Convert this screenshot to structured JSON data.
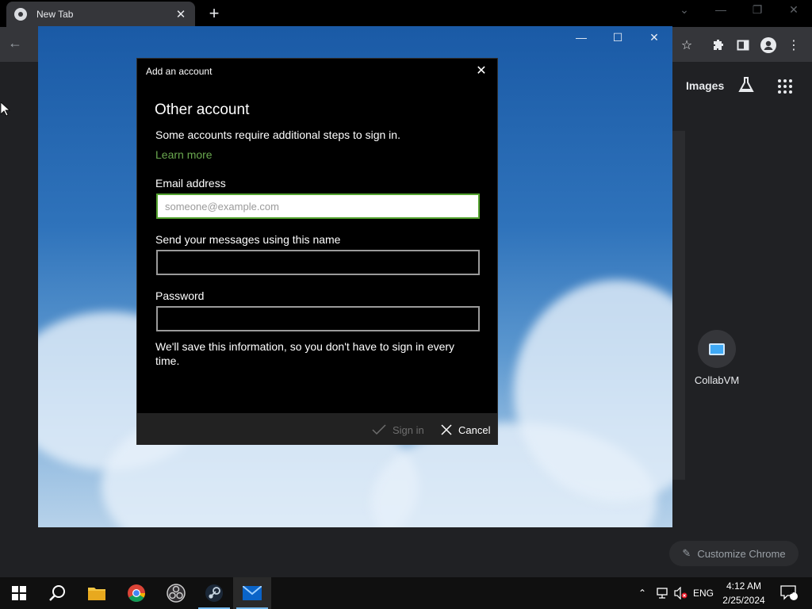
{
  "browser": {
    "tab_title": "New Tab",
    "tab_close": "✕",
    "new_tab": "+"
  },
  "page": {
    "images_link": "Images",
    "shortcut_label": "CollabVM",
    "customize_label": "Customize Chrome"
  },
  "dialog": {
    "title": "Add an account",
    "heading": "Other account",
    "description": "Some accounts require additional steps to sign in.",
    "learn_more": "Learn more",
    "email_label": "Email address",
    "email_placeholder": "someone@example.com",
    "email_value": "",
    "name_label": "Send your messages using this name",
    "name_value": "",
    "password_label": "Password",
    "password_value": "",
    "note": "We'll save this information, so you don't have to sign in every time.",
    "sign_in": "Sign in",
    "cancel": "Cancel"
  },
  "taskbar": {
    "language": "ENG",
    "time": "4:12 AM",
    "date": "2/25/2024",
    "notification_count": "9"
  },
  "colors": {
    "focus_border": "#54a22f",
    "link": "#6aa84f",
    "accent": "#76b9ed"
  }
}
